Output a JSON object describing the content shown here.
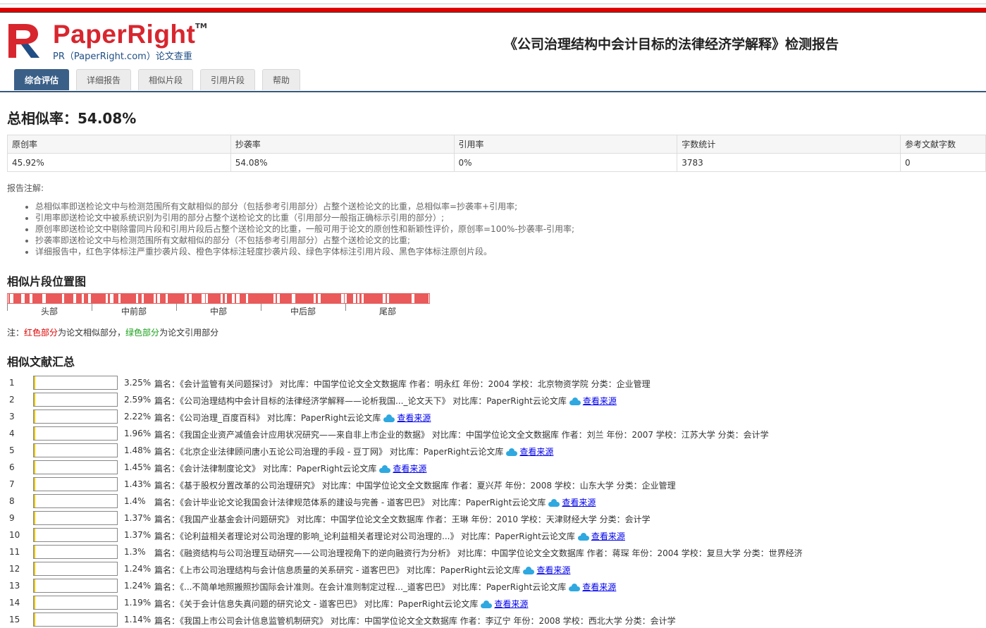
{
  "header": {
    "logo_text": "PaperRight",
    "logo_tm": "TM",
    "logo_sub": "PR（PaperRight.com）论文查重",
    "report_title": "《公司治理结构中会计目标的法律经济学解释》检测报告"
  },
  "tabs": [
    "综合评估",
    "详细报告",
    "相似片段",
    "引用片段",
    "帮助"
  ],
  "summary": {
    "title": "总相似率：54.08%",
    "headers": [
      "原创率",
      "抄袭率",
      "引用率",
      "字数统计",
      "参考文献字数"
    ],
    "values": [
      "45.92%",
      "54.08%",
      "0%",
      "3783",
      "0"
    ]
  },
  "notes": {
    "title": "报告注解:",
    "items": [
      "总相似率即送检论文中与检测范围所有文献相似的部分（包括参考引用部分）占整个送检论文的比重，总相似率=抄袭率+引用率;",
      "引用率即送检论文中被系统识别为引用的部分占整个送检论文的比重（引用部分一般指正确标示引用的部分）;",
      "原创率即送检论文中剔除雷同片段和引用片段后占整个送检论文的比重，一般可用于论文的原创性和新颖性评价，原创率=100%-抄袭率-引用率;",
      "抄袭率即送检论文中与检测范围所有文献相似的部分（不包括参考引用部分）占整个送检论文的比重;",
      "详细报告中，红色字体标注严重抄袭片段、橙色字体标注轻度抄袭片段、绿色字体标注引用片段、黑色字体标注原创片段。"
    ]
  },
  "position_map": {
    "title": "相似片段位置图",
    "labels": [
      "头部",
      "中前部",
      "中部",
      "中后部",
      "尾部"
    ],
    "note_prefix": "注：",
    "note_red": "红色部分",
    "note_mid": "为论文相似部分，",
    "note_green": "绿色部分",
    "note_end": "为论文引用部分",
    "segments": [
      [
        0.002,
        0.006
      ],
      [
        0.014,
        0.032
      ],
      [
        0.04,
        0.052
      ],
      [
        0.058,
        0.082
      ],
      [
        0.09,
        0.128
      ],
      [
        0.134,
        0.155
      ],
      [
        0.162,
        0.175
      ],
      [
        0.18,
        0.19
      ],
      [
        0.197,
        0.232
      ],
      [
        0.238,
        0.243
      ],
      [
        0.25,
        0.262
      ],
      [
        0.268,
        0.305
      ],
      [
        0.31,
        0.318
      ],
      [
        0.323,
        0.346
      ],
      [
        0.352,
        0.356
      ],
      [
        0.362,
        0.376
      ],
      [
        0.38,
        0.42
      ],
      [
        0.425,
        0.43
      ],
      [
        0.436,
        0.46
      ],
      [
        0.468,
        0.47
      ],
      [
        0.475,
        0.505
      ],
      [
        0.51,
        0.515
      ],
      [
        0.52,
        0.532
      ],
      [
        0.538,
        0.542
      ],
      [
        0.55,
        0.565
      ],
      [
        0.57,
        0.63
      ],
      [
        0.636,
        0.64
      ],
      [
        0.646,
        0.674
      ],
      [
        0.682,
        0.725
      ],
      [
        0.73,
        0.735
      ],
      [
        0.742,
        0.79
      ],
      [
        0.798,
        0.8
      ],
      [
        0.805,
        0.82
      ],
      [
        0.826,
        0.83
      ],
      [
        0.835,
        0.84
      ],
      [
        0.845,
        0.89
      ],
      [
        0.897,
        0.9
      ],
      [
        0.905,
        0.958
      ],
      [
        0.965,
        0.998
      ]
    ]
  },
  "similar_docs": {
    "title": "相似文献汇总",
    "view_link": "查看来源",
    "rows": [
      {
        "num": "1",
        "pct": "3.25%",
        "fill": 0.0325,
        "pre": "篇名：《会计监管有关问题探讨》 对比库：中国学位论文全文数据库 作者：明永红 年份：2004 学校：北京物资学院 分类：企业管理",
        "link": false
      },
      {
        "num": "2",
        "pct": "2.59%",
        "fill": 0.0259,
        "pre": "篇名：《公司治理结构中会计目标的法律经济学解释——论析我国..._论文天下》 对比库：PaperRight云论文库",
        "link": true
      },
      {
        "num": "3",
        "pct": "2.22%",
        "fill": 0.0222,
        "pre": "篇名：《公司治理_百度百科》 对比库：PaperRight云论文库",
        "link": true
      },
      {
        "num": "4",
        "pct": "1.96%",
        "fill": 0.0196,
        "pre": "篇名：《我国企业资产减值会计应用状况研究——来自非上市企业的数据》 对比库：中国学位论文全文数据库 作者：刘兰 年份：2007 学校：江苏大学 分类：会计学",
        "link": false
      },
      {
        "num": "5",
        "pct": "1.48%",
        "fill": 0.0148,
        "pre": "篇名：《北京企业法律顾问唐小五论公司治理的手段 - 豆丁网》 对比库：PaperRight云论文库",
        "link": true
      },
      {
        "num": "6",
        "pct": "1.45%",
        "fill": 0.0145,
        "pre": "篇名：《会计法律制度论文》 对比库：PaperRight云论文库",
        "link": true
      },
      {
        "num": "7",
        "pct": "1.43%",
        "fill": 0.0143,
        "pre": "篇名：《基于股权分置改革的公司治理研究》 对比库：中国学位论文全文数据库 作者：夏兴芹 年份：2008 学校：山东大学 分类：企业管理",
        "link": false
      },
      {
        "num": "8",
        "pct": "1.4%",
        "fill": 0.014,
        "pre": "篇名：《会计毕业论文论我国会计法律规范体系的建设与完善 - 道客巴巴》 对比库：PaperRight云论文库",
        "link": true
      },
      {
        "num": "9",
        "pct": "1.37%",
        "fill": 0.0137,
        "pre": "篇名：《我国产业基金会计问题研究》 对比库：中国学位论文全文数据库 作者：王琳 年份：2010 学校：天津财经大学 分类：会计学",
        "link": false
      },
      {
        "num": "10",
        "pct": "1.37%",
        "fill": 0.0137,
        "pre": "篇名：《论利益相关者理论对公司治理的影响_论利益相关者理论对公司治理的...》 对比库：PaperRight云论文库",
        "link": true
      },
      {
        "num": "11",
        "pct": "1.3%",
        "fill": 0.013,
        "pre": "篇名：《融资结构与公司治理互动研究——公司治理视角下的逆向融资行为分析》 对比库：中国学位论文全文数据库 作者：蒋琛 年份：2004 学校：复旦大学 分类：世界经济",
        "link": false
      },
      {
        "num": "12",
        "pct": "1.24%",
        "fill": 0.0124,
        "pre": "篇名：《上市公司治理结构与会计信息质量的关系研究 - 道客巴巴》 对比库：PaperRight云论文库",
        "link": true
      },
      {
        "num": "13",
        "pct": "1.24%",
        "fill": 0.0124,
        "pre": "篇名：《...不简单地照搬照抄国际会计准则。在会计准则制定过程..._道客巴巴》 对比库：PaperRight云论文库",
        "link": true
      },
      {
        "num": "14",
        "pct": "1.19%",
        "fill": 0.0119,
        "pre": "篇名：《关于会计信息失真问题的研究论文 - 道客巴巴》 对比库：PaperRight云论文库",
        "link": true
      },
      {
        "num": "15",
        "pct": "1.14%",
        "fill": 0.0114,
        "pre": "篇名：《我国上市公司会计信息监管机制研究》 对比库：中国学位论文全文数据库 作者：李辽宁 年份：2008 学校：西北大学 分类：会计学",
        "link": false
      }
    ]
  }
}
